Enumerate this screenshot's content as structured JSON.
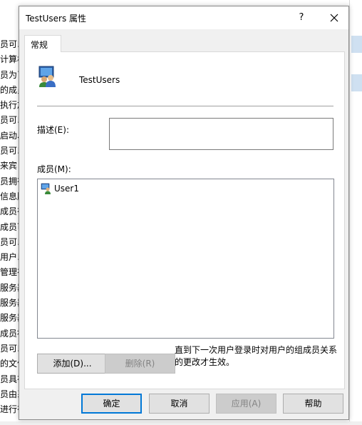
{
  "background": {
    "left_fragments": [
      "员可以",
      "计算机",
      "员为了",
      "的成员",
      "执行加",
      "员可以",
      "启动、",
      "员可以",
      "来宾",
      "员拥有",
      "信息服",
      "成员有",
      "成员可",
      "员可以",
      "用户以",
      "管理在",
      "服务器",
      "服务器",
      "服务器",
      "成员被",
      "员可以",
      "的文件",
      "员具有",
      "员由系",
      "进行有"
    ]
  },
  "dialog": {
    "title": "TestUsers 属性",
    "help_label": "?",
    "tab_label": "常规",
    "group_name": "TestUsers",
    "description_label": "描述(E):",
    "description_value": "",
    "members_label": "成员(M):",
    "members": [
      {
        "name": "User1",
        "icon": "user-icon"
      }
    ],
    "add_label": "添加(D)...",
    "remove_label": "删除(R)",
    "note": "直到下一次用户登录时对用户的组成员关系的更改才生效。",
    "ok_label": "确定",
    "cancel_label": "取消",
    "apply_label": "应用(A)",
    "help_button_label": "帮助"
  },
  "colors": {
    "accent": "#0078d7",
    "dialog_bg": "#f0f0f0",
    "disabled_text": "#838383"
  }
}
